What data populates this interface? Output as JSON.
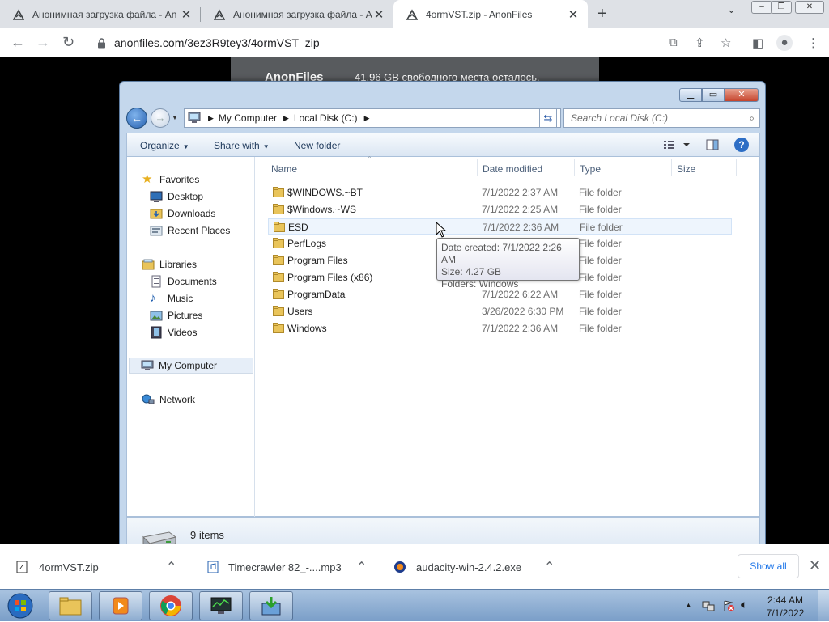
{
  "browser": {
    "tabs": [
      {
        "title": "Анонимная загрузка файла - An"
      },
      {
        "title": "Анонимная загрузка файла - An"
      },
      {
        "title": "4ormVST.zip - AnonFiles"
      }
    ],
    "url": "anonfiles.com/3ez3R9tey3/4ormVST_zip"
  },
  "page": {
    "brand": "AnonFiles",
    "free_space": "41.96 GB свободного места осталось."
  },
  "explorer": {
    "breadcrumb": [
      "My Computer",
      "Local Disk (C:)"
    ],
    "search_placeholder": "Search Local Disk (C:)",
    "commands": {
      "organize": "Organize",
      "share": "Share with",
      "newfolder": "New folder"
    },
    "nav": {
      "favorites": "Favorites",
      "desktop": "Desktop",
      "downloads": "Downloads",
      "recent": "Recent Places",
      "libraries": "Libraries",
      "documents": "Documents",
      "music": "Music",
      "pictures": "Pictures",
      "videos": "Videos",
      "computer": "My Computer",
      "network": "Network"
    },
    "columns": {
      "name": "Name",
      "date": "Date modified",
      "type": "Type",
      "size": "Size"
    },
    "rows": [
      {
        "name": "$WINDOWS.~BT",
        "date": "7/1/2022 2:37 AM",
        "type": "File folder"
      },
      {
        "name": "$Windows.~WS",
        "date": "7/1/2022 2:25 AM",
        "type": "File folder"
      },
      {
        "name": "ESD",
        "date": "7/1/2022 2:36 AM",
        "type": "File folder"
      },
      {
        "name": "PerfLogs",
        "date": "",
        "type": "File folder"
      },
      {
        "name": "Program Files",
        "date": "",
        "type": "File folder"
      },
      {
        "name": "Program Files (x86)",
        "date": "7/1/2022 2:41 AM",
        "type": "File folder"
      },
      {
        "name": "ProgramData",
        "date": "7/1/2022 6:22 AM",
        "type": "File folder"
      },
      {
        "name": "Users",
        "date": "3/26/2022 6:30 PM",
        "type": "File folder"
      },
      {
        "name": "Windows",
        "date": "7/1/2022 2:36 AM",
        "type": "File folder"
      }
    ],
    "tooltip": [
      "Date created: 7/1/2022 2:26 AM",
      "Size: 4.27 GB",
      "Folders: Windows"
    ],
    "item_count": "9 items"
  },
  "downloads": {
    "items": [
      {
        "name": "4ormVST.zip"
      },
      {
        "name": "Timecrawler 82_-....mp3"
      },
      {
        "name": "audacity-win-2.4.2.exe"
      }
    ],
    "show_all": "Show all"
  },
  "taskbar": {
    "time": "2:44 AM",
    "date": "7/1/2022"
  }
}
